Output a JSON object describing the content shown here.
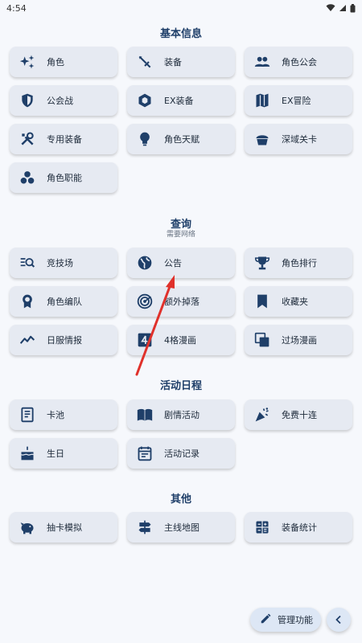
{
  "status": {
    "time": "4:54"
  },
  "sections": {
    "basic": {
      "title": "基本信息"
    },
    "query": {
      "title": "查询",
      "subtitle": "需要网络"
    },
    "event": {
      "title": "活动日程"
    },
    "other": {
      "title": "其他"
    }
  },
  "basic_items": [
    {
      "label": "角色",
      "icon": "sparkle-icon"
    },
    {
      "label": "装备",
      "icon": "sword-icon"
    },
    {
      "label": "角色公会",
      "icon": "group-icon"
    },
    {
      "label": "公会战",
      "icon": "shield-icon"
    },
    {
      "label": "EX装备",
      "icon": "box-icon"
    },
    {
      "label": "EX冒险",
      "icon": "map-icon"
    },
    {
      "label": "专用装备",
      "icon": "tools-icon"
    },
    {
      "label": "角色天赋",
      "icon": "bulb-icon"
    },
    {
      "label": "深域关卡",
      "icon": "cake-icon"
    },
    {
      "label": "角色职能",
      "icon": "circles-icon"
    }
  ],
  "query_items": [
    {
      "label": "竞技场",
      "icon": "search-list-icon"
    },
    {
      "label": "公告",
      "icon": "globe-icon"
    },
    {
      "label": "角色排行",
      "icon": "trophy-icon"
    },
    {
      "label": "角色编队",
      "icon": "badge-icon"
    },
    {
      "label": "额外掉落",
      "icon": "radar-icon"
    },
    {
      "label": "收藏夹",
      "icon": "bookmark-icon"
    },
    {
      "label": "日服情报",
      "icon": "trend-icon"
    },
    {
      "label": "4格漫画",
      "icon": "four-box-icon"
    },
    {
      "label": "过场漫画",
      "icon": "layers-icon"
    }
  ],
  "event_items": [
    {
      "label": "卡池",
      "icon": "receipt-icon"
    },
    {
      "label": "剧情活动",
      "icon": "book-icon"
    },
    {
      "label": "免费十连",
      "icon": "party-icon"
    },
    {
      "label": "生日",
      "icon": "birthday-cake-icon"
    },
    {
      "label": "活动记录",
      "icon": "calendar-icon"
    }
  ],
  "other_items": [
    {
      "label": "抽卡模拟",
      "icon": "piggy-bank-icon"
    },
    {
      "label": "主线地图",
      "icon": "signpost-icon"
    },
    {
      "label": "装备统计",
      "icon": "grid-calc-icon"
    }
  ],
  "fab": {
    "label": "管理功能"
  },
  "colors": {
    "accent": "#1f3f69",
    "tile": "#e6eaf2",
    "annotation": "#e0312b"
  }
}
